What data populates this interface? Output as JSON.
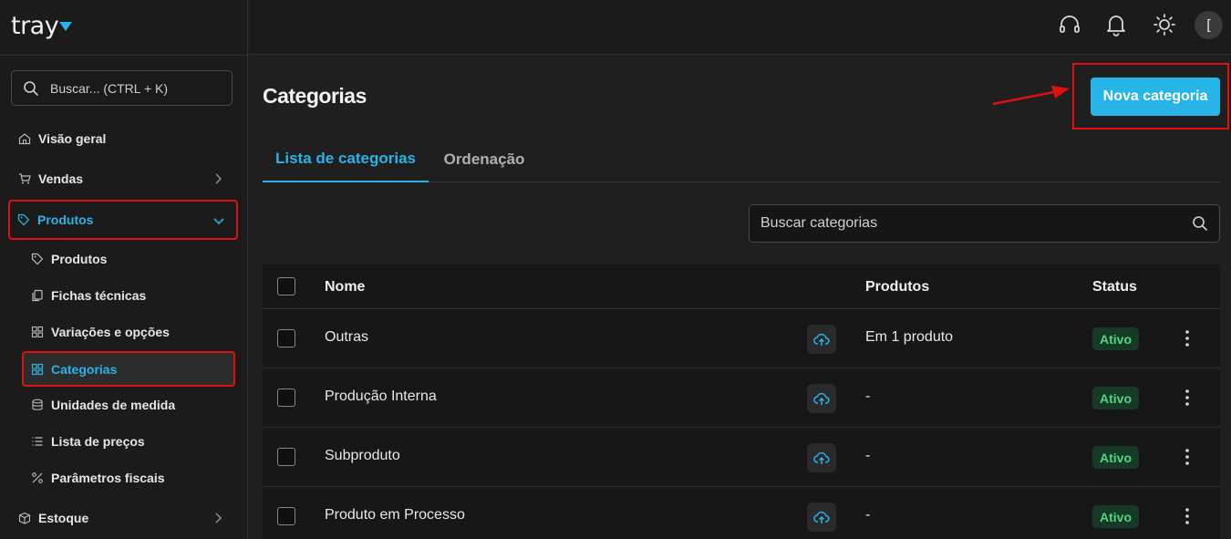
{
  "brand": {
    "logo_text": "tray",
    "accent": "#27b4e8",
    "highlight": "#e01010"
  },
  "sidebar": {
    "search_placeholder": "Buscar... (CTRL + K)",
    "items": [
      {
        "label": "Visão geral",
        "icon": "home-icon"
      },
      {
        "label": "Vendas",
        "icon": "cart-icon"
      },
      {
        "label": "Produtos",
        "icon": "tag-icon",
        "active": true
      },
      {
        "label": "Estoque",
        "icon": "box-icon"
      }
    ],
    "subitems": [
      {
        "label": "Produtos",
        "icon": "tag-icon"
      },
      {
        "label": "Fichas técnicas",
        "icon": "copy-icon"
      },
      {
        "label": "Variações e opções",
        "icon": "grid-icon"
      },
      {
        "label": "Categorias",
        "icon": "categories-icon",
        "active": true
      },
      {
        "label": "Unidades de medida",
        "icon": "database-icon"
      },
      {
        "label": "Lista de preços",
        "icon": "list-icon"
      },
      {
        "label": "Parâmetros fiscais",
        "icon": "percent-icon"
      }
    ]
  },
  "topbar": {
    "avatar_text": "["
  },
  "main": {
    "title": "Categorias",
    "new_button": "Nova categoria",
    "tabs": [
      {
        "label": "Lista de categorias",
        "active": true
      },
      {
        "label": "Ordenação",
        "active": false
      }
    ],
    "search_placeholder": "Buscar categorias",
    "table": {
      "headers": {
        "name": "Nome",
        "products": "Produtos",
        "status": "Status"
      },
      "rows": [
        {
          "name": "Outras",
          "products": "Em 1 produto",
          "status": "Ativo"
        },
        {
          "name": "Produção Interna",
          "products": "-",
          "status": "Ativo"
        },
        {
          "name": "Subproduto",
          "products": "-",
          "status": "Ativo"
        },
        {
          "name": "Produto em Processo",
          "products": "-",
          "status": "Ativo"
        }
      ]
    }
  }
}
